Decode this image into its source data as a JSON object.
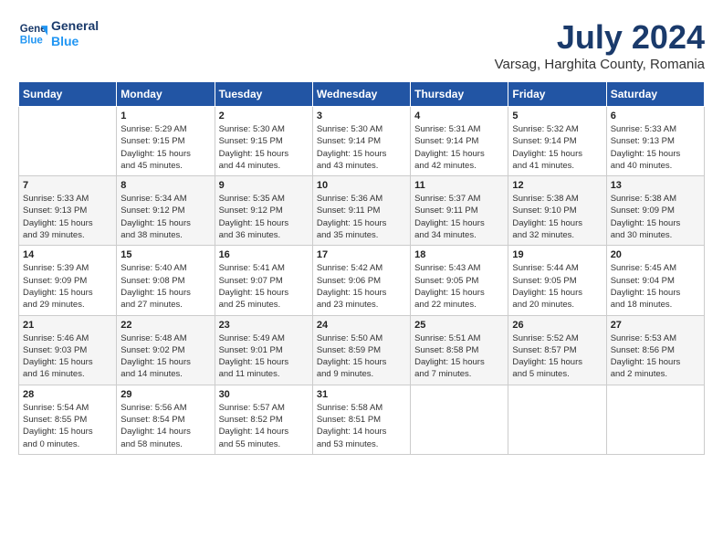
{
  "logo": {
    "line1": "General",
    "line2": "Blue"
  },
  "title": "July 2024",
  "location": "Varsag, Harghita County, Romania",
  "weekdays": [
    "Sunday",
    "Monday",
    "Tuesday",
    "Wednesday",
    "Thursday",
    "Friday",
    "Saturday"
  ],
  "weeks": [
    [
      {
        "day": "",
        "info": ""
      },
      {
        "day": "1",
        "info": "Sunrise: 5:29 AM\nSunset: 9:15 PM\nDaylight: 15 hours\nand 45 minutes."
      },
      {
        "day": "2",
        "info": "Sunrise: 5:30 AM\nSunset: 9:15 PM\nDaylight: 15 hours\nand 44 minutes."
      },
      {
        "day": "3",
        "info": "Sunrise: 5:30 AM\nSunset: 9:14 PM\nDaylight: 15 hours\nand 43 minutes."
      },
      {
        "day": "4",
        "info": "Sunrise: 5:31 AM\nSunset: 9:14 PM\nDaylight: 15 hours\nand 42 minutes."
      },
      {
        "day": "5",
        "info": "Sunrise: 5:32 AM\nSunset: 9:14 PM\nDaylight: 15 hours\nand 41 minutes."
      },
      {
        "day": "6",
        "info": "Sunrise: 5:33 AM\nSunset: 9:13 PM\nDaylight: 15 hours\nand 40 minutes."
      }
    ],
    [
      {
        "day": "7",
        "info": "Sunrise: 5:33 AM\nSunset: 9:13 PM\nDaylight: 15 hours\nand 39 minutes."
      },
      {
        "day": "8",
        "info": "Sunrise: 5:34 AM\nSunset: 9:12 PM\nDaylight: 15 hours\nand 38 minutes."
      },
      {
        "day": "9",
        "info": "Sunrise: 5:35 AM\nSunset: 9:12 PM\nDaylight: 15 hours\nand 36 minutes."
      },
      {
        "day": "10",
        "info": "Sunrise: 5:36 AM\nSunset: 9:11 PM\nDaylight: 15 hours\nand 35 minutes."
      },
      {
        "day": "11",
        "info": "Sunrise: 5:37 AM\nSunset: 9:11 PM\nDaylight: 15 hours\nand 34 minutes."
      },
      {
        "day": "12",
        "info": "Sunrise: 5:38 AM\nSunset: 9:10 PM\nDaylight: 15 hours\nand 32 minutes."
      },
      {
        "day": "13",
        "info": "Sunrise: 5:38 AM\nSunset: 9:09 PM\nDaylight: 15 hours\nand 30 minutes."
      }
    ],
    [
      {
        "day": "14",
        "info": "Sunrise: 5:39 AM\nSunset: 9:09 PM\nDaylight: 15 hours\nand 29 minutes."
      },
      {
        "day": "15",
        "info": "Sunrise: 5:40 AM\nSunset: 9:08 PM\nDaylight: 15 hours\nand 27 minutes."
      },
      {
        "day": "16",
        "info": "Sunrise: 5:41 AM\nSunset: 9:07 PM\nDaylight: 15 hours\nand 25 minutes."
      },
      {
        "day": "17",
        "info": "Sunrise: 5:42 AM\nSunset: 9:06 PM\nDaylight: 15 hours\nand 23 minutes."
      },
      {
        "day": "18",
        "info": "Sunrise: 5:43 AM\nSunset: 9:05 PM\nDaylight: 15 hours\nand 22 minutes."
      },
      {
        "day": "19",
        "info": "Sunrise: 5:44 AM\nSunset: 9:05 PM\nDaylight: 15 hours\nand 20 minutes."
      },
      {
        "day": "20",
        "info": "Sunrise: 5:45 AM\nSunset: 9:04 PM\nDaylight: 15 hours\nand 18 minutes."
      }
    ],
    [
      {
        "day": "21",
        "info": "Sunrise: 5:46 AM\nSunset: 9:03 PM\nDaylight: 15 hours\nand 16 minutes."
      },
      {
        "day": "22",
        "info": "Sunrise: 5:48 AM\nSunset: 9:02 PM\nDaylight: 15 hours\nand 14 minutes."
      },
      {
        "day": "23",
        "info": "Sunrise: 5:49 AM\nSunset: 9:01 PM\nDaylight: 15 hours\nand 11 minutes."
      },
      {
        "day": "24",
        "info": "Sunrise: 5:50 AM\nSunset: 8:59 PM\nDaylight: 15 hours\nand 9 minutes."
      },
      {
        "day": "25",
        "info": "Sunrise: 5:51 AM\nSunset: 8:58 PM\nDaylight: 15 hours\nand 7 minutes."
      },
      {
        "day": "26",
        "info": "Sunrise: 5:52 AM\nSunset: 8:57 PM\nDaylight: 15 hours\nand 5 minutes."
      },
      {
        "day": "27",
        "info": "Sunrise: 5:53 AM\nSunset: 8:56 PM\nDaylight: 15 hours\nand 2 minutes."
      }
    ],
    [
      {
        "day": "28",
        "info": "Sunrise: 5:54 AM\nSunset: 8:55 PM\nDaylight: 15 hours\nand 0 minutes."
      },
      {
        "day": "29",
        "info": "Sunrise: 5:56 AM\nSunset: 8:54 PM\nDaylight: 14 hours\nand 58 minutes."
      },
      {
        "day": "30",
        "info": "Sunrise: 5:57 AM\nSunset: 8:52 PM\nDaylight: 14 hours\nand 55 minutes."
      },
      {
        "day": "31",
        "info": "Sunrise: 5:58 AM\nSunset: 8:51 PM\nDaylight: 14 hours\nand 53 minutes."
      },
      {
        "day": "",
        "info": ""
      },
      {
        "day": "",
        "info": ""
      },
      {
        "day": "",
        "info": ""
      }
    ]
  ]
}
